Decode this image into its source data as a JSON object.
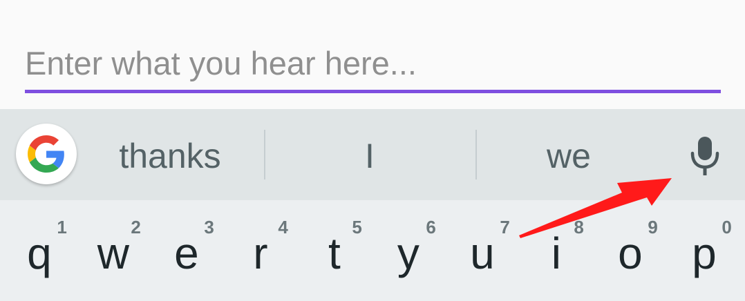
{
  "input": {
    "placeholder": "Enter what you hear here...",
    "value": "",
    "underline_color": "#7e4fe0"
  },
  "keyboard": {
    "suggestion_strip": {
      "google_icon": "google-g-logo",
      "suggestions": [
        "thanks",
        "I",
        "we"
      ],
      "mic_icon": "microphone-icon"
    },
    "rows": [
      {
        "keys": [
          {
            "letter": "q",
            "hint": "1"
          },
          {
            "letter": "w",
            "hint": "2"
          },
          {
            "letter": "e",
            "hint": "3"
          },
          {
            "letter": "r",
            "hint": "4"
          },
          {
            "letter": "t",
            "hint": "5"
          },
          {
            "letter": "y",
            "hint": "6"
          },
          {
            "letter": "u",
            "hint": "7"
          },
          {
            "letter": "i",
            "hint": "8"
          },
          {
            "letter": "o",
            "hint": "9"
          },
          {
            "letter": "p",
            "hint": "0"
          }
        ]
      }
    ]
  },
  "annotation": {
    "arrow_color": "#ff1a1a",
    "arrow_target": "microphone-icon"
  }
}
